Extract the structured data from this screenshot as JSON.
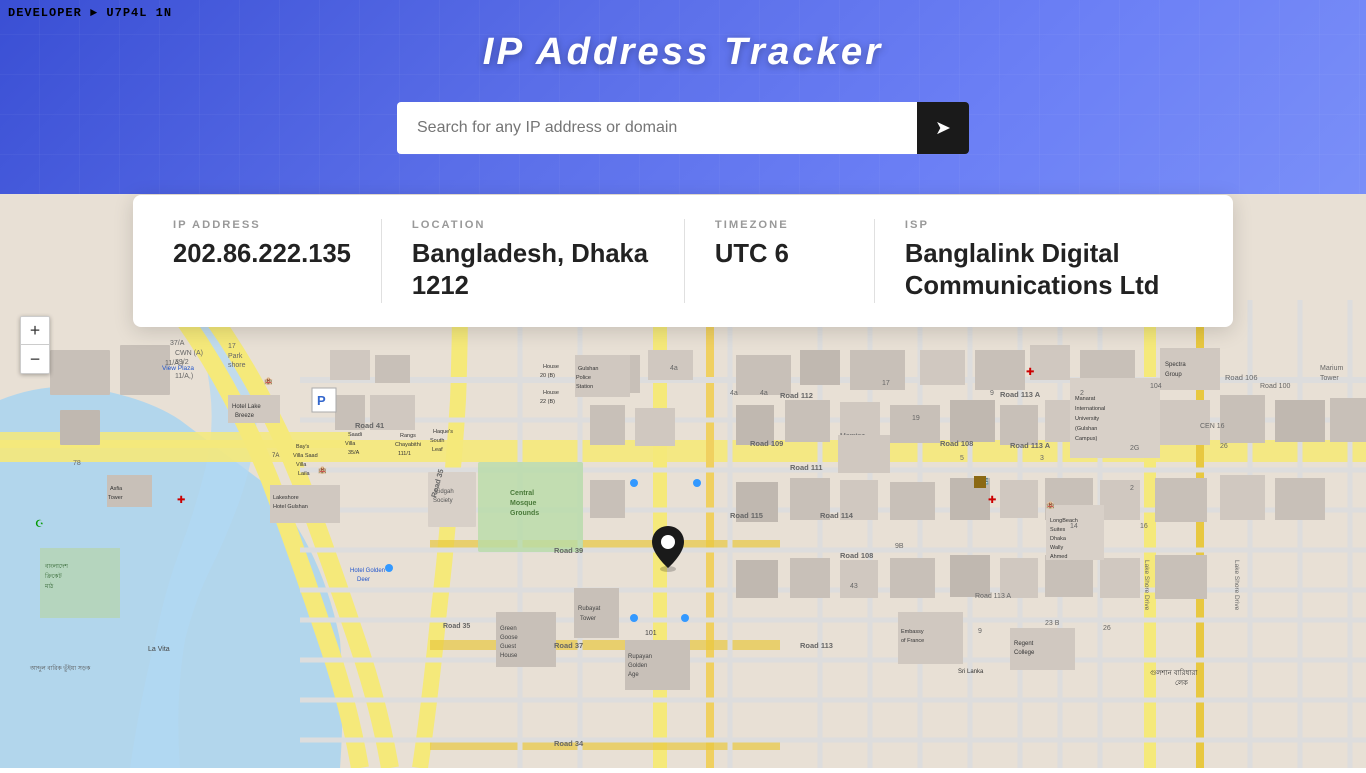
{
  "dev_tag": "DEVELOPER ► U7P4L 1N",
  "app": {
    "title": "IP  Address  Tracker"
  },
  "search": {
    "placeholder": "Search for any IP address or domain",
    "button_icon": "➤"
  },
  "info_card": {
    "ip_label": "IP ADDRESS",
    "ip_value": "202.86.222.135",
    "location_label": "LOCATION",
    "location_value": "Bangladesh, Dhaka 1212",
    "timezone_label": "TIMEZONE",
    "timezone_value": "UTC 6",
    "isp_label": "ISP",
    "isp_value": "Banglalink Digital Communications Ltd"
  },
  "zoom": {
    "plus": "+",
    "minus": "−"
  },
  "map": {
    "center_lat": 23.75,
    "center_lng": 90.41,
    "pin_label": "location pin"
  }
}
